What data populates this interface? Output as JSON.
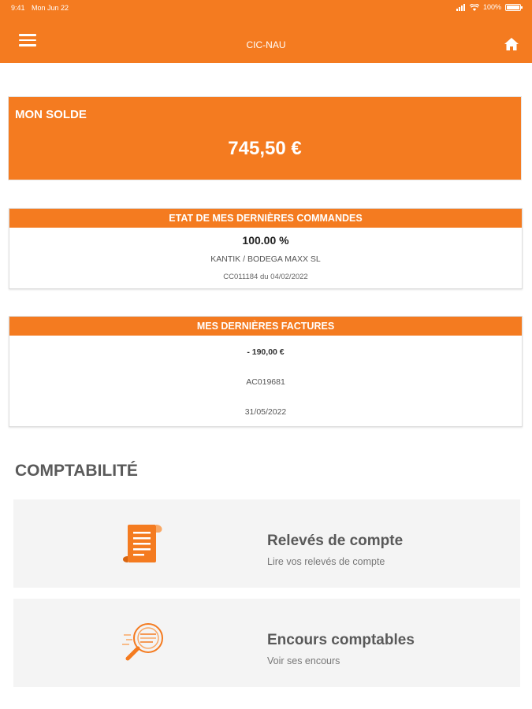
{
  "status_bar": {
    "time": "9:41",
    "date": "Mon Jun 22",
    "battery": "100%",
    "battery_level": 1.0
  },
  "header": {
    "title": "CIC-NAU",
    "menu_icon": "menu-icon",
    "home_icon": "home-icon"
  },
  "balance": {
    "label": "MON SOLDE",
    "amount": "745,50 €"
  },
  "orders": {
    "title": "ETAT DE MES DERNIÈRES COMMANDES",
    "percent": "100.00 %",
    "customer": "KANTIK / BODEGA MAXX SL",
    "reference": "CC011184 du 04/02/2022"
  },
  "invoices": {
    "title": "MES DERNIÈRES FACTURES",
    "amount": "- 190,00 €",
    "number": "AC019681",
    "date": "31/05/2022"
  },
  "accounting": {
    "title": "COMPTABILITÉ",
    "tiles": [
      {
        "icon": "scroll-document-icon",
        "title": "Relevés de compte",
        "subtitle": "Lire vos relevés de compte"
      },
      {
        "icon": "magnifier-search-icon",
        "title": "Encours comptables",
        "subtitle": "Voir ses encours"
      }
    ]
  },
  "colors": {
    "accent": "#f47b20",
    "tile_bg": "#f4f4f4",
    "heading_gray": "#5a5a5a"
  }
}
